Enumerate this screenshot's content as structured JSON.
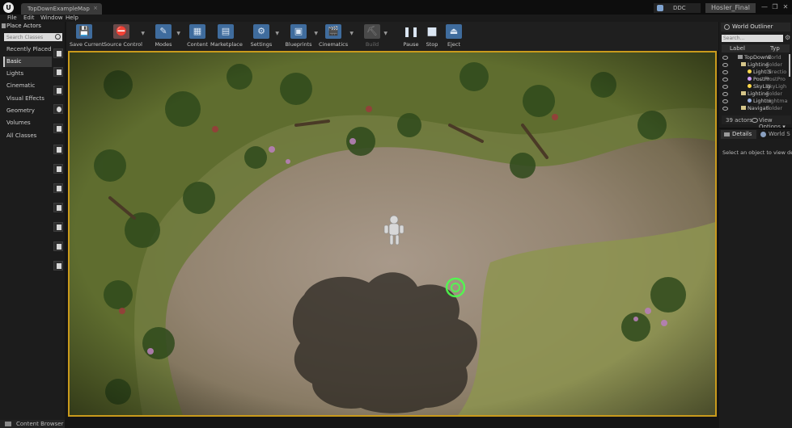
{
  "title_bar": {
    "logo": "U",
    "document_tab": "TopDownExampleMap",
    "ddc_label": "DDC",
    "project_name": "Hosler_Final",
    "window_buttons": [
      "—",
      "❐",
      "✕"
    ]
  },
  "menu": [
    "File",
    "Edit",
    "Window",
    "Help"
  ],
  "place_actors": {
    "title": "Place Actors",
    "search_placeholder": "Search Classes",
    "categories": [
      "Recently Placed",
      "Basic",
      "Lights",
      "Cinematic",
      "Visual Effects",
      "Geometry",
      "Volumes",
      "All Classes"
    ],
    "selected_category": "Basic"
  },
  "toolbar": {
    "items": [
      {
        "label": "Save Current",
        "icon": "save-icon",
        "glyph": "💾"
      },
      {
        "label": "Source Control",
        "icon": "source-control-icon",
        "glyph": "⛔"
      },
      {
        "label": "Modes",
        "icon": "modes-icon",
        "glyph": "✎"
      },
      {
        "label": "Content",
        "icon": "content-icon",
        "glyph": "▦"
      },
      {
        "label": "Marketplace",
        "icon": "marketplace-icon",
        "glyph": "▤"
      },
      {
        "label": "Settings",
        "icon": "settings-icon",
        "glyph": "⚙"
      },
      {
        "label": "Blueprints",
        "icon": "blueprints-icon",
        "glyph": "▣"
      },
      {
        "label": "Cinematics",
        "icon": "cinematics-icon",
        "glyph": "🎬"
      },
      {
        "label": "Build",
        "icon": "build-icon",
        "glyph": "⛏"
      },
      {
        "label": "Pause",
        "icon": "pause-icon",
        "glyph": "❚❚"
      },
      {
        "label": "Stop",
        "icon": "stop-icon",
        "glyph": "■"
      },
      {
        "label": "Eject",
        "icon": "eject-icon",
        "glyph": "⏏"
      }
    ]
  },
  "world_outliner": {
    "title": "World Outliner",
    "search_placeholder": "Search...",
    "columns": [
      "Label",
      "Typ"
    ],
    "rows": [
      {
        "label": "TopDownE",
        "type": "World"
      },
      {
        "label": "Lighting",
        "type": "Folder"
      },
      {
        "label": "Light S",
        "type": "Directio"
      },
      {
        "label": "PostPr",
        "type": "PostPro"
      },
      {
        "label": "SkyLig",
        "type": "SkyLigh"
      },
      {
        "label": "Lighting",
        "type": "Folder"
      },
      {
        "label": "Lightm",
        "type": "Lightmass"
      },
      {
        "label": "Navigati",
        "type": "Folder"
      }
    ],
    "actor_count": "39 actors",
    "view_options": "View Options"
  },
  "details": {
    "tab_label": "Details",
    "world_settings_tab": "World S",
    "empty_message": "Select an object to view details."
  },
  "content_browser": {
    "tab_label": "Content Browser"
  },
  "colors": {
    "viewport_border": "#c99a1c",
    "selection_ring": "#4cff4c",
    "toolbar_icon": "#3f6c9d"
  }
}
